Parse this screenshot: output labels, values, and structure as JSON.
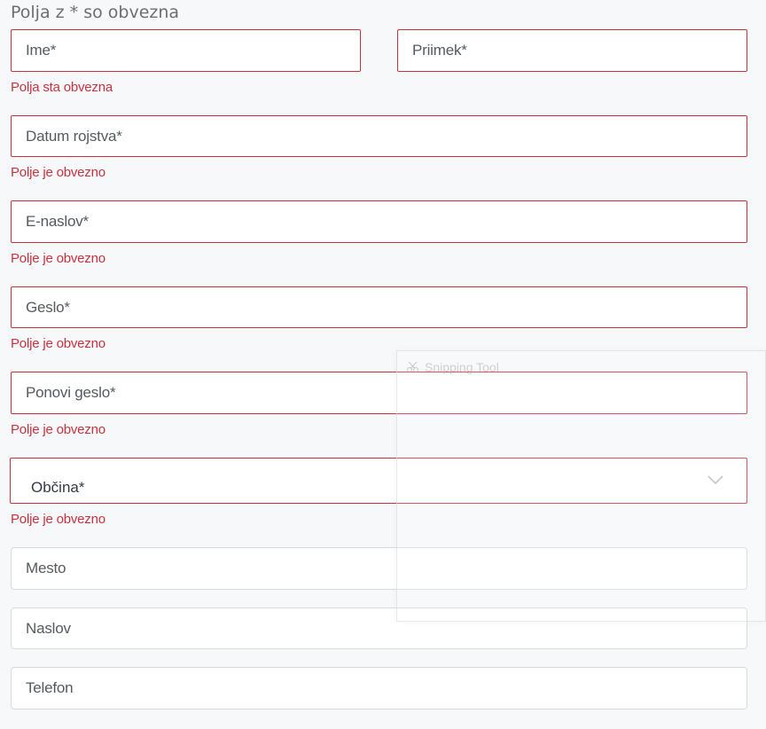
{
  "notice": "Polja z * so obvezna",
  "fields": {
    "ime": {
      "placeholder": "Ime*"
    },
    "priimek": {
      "placeholder": "Priimek*"
    },
    "name_error": "Polja sta obvezna",
    "datum": {
      "placeholder": "Datum rojstva*",
      "error": "Polje je obvezno"
    },
    "email": {
      "placeholder": "E-naslov*",
      "error": "Polje je obvezno"
    },
    "geslo": {
      "placeholder": "Geslo*",
      "error": "Polje je obvezno"
    },
    "ponovi": {
      "placeholder": "Ponovi geslo*",
      "error": "Polje je obvezno"
    },
    "obcina": {
      "label": "Občina*",
      "error": "Polje je obvezno"
    },
    "mesto": {
      "placeholder": "Mesto"
    },
    "naslov": {
      "placeholder": "Naslov"
    },
    "telefon": {
      "placeholder": "Telefon"
    }
  },
  "overlay": {
    "title": "Snipping Tool",
    "icon": "scissors-icon"
  },
  "colors": {
    "error": "#c8323e",
    "border_neutral": "#d7dadf",
    "background": "#f7f8fa",
    "text": "#555a60"
  }
}
